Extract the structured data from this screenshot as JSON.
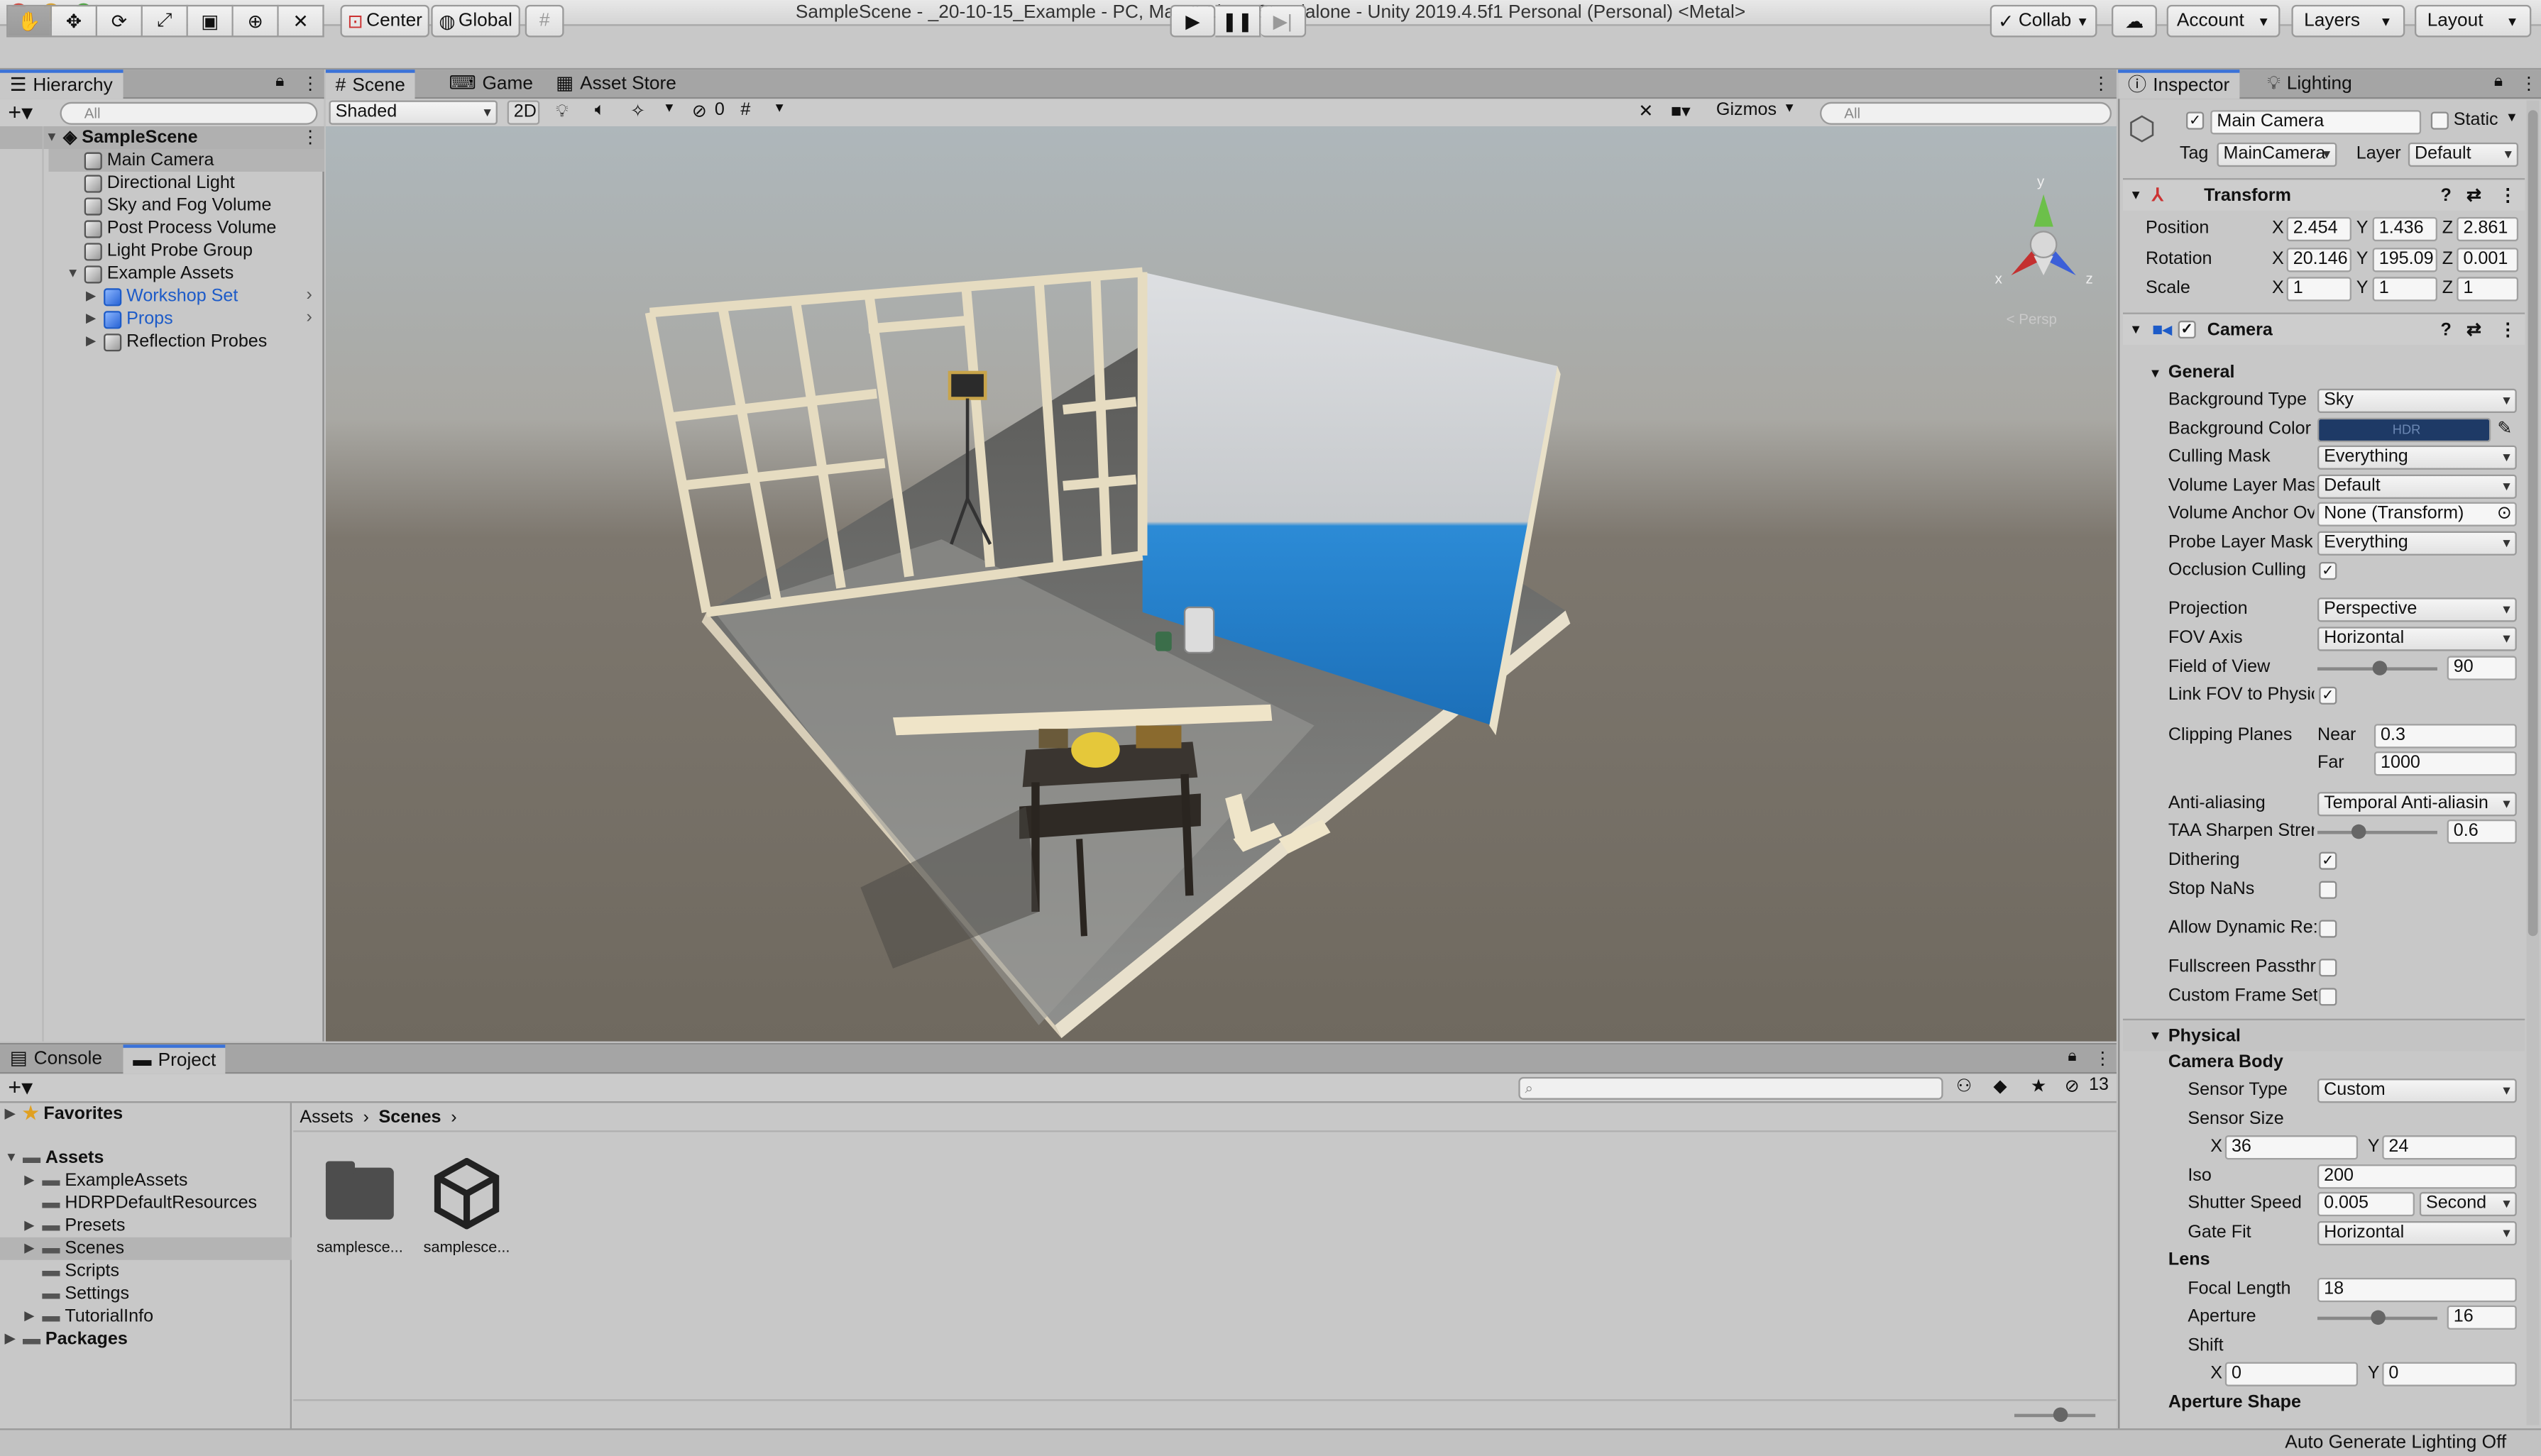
{
  "window": {
    "title": "SampleScene - _20-10-15_Example - PC, Mac & Linux Standalone - Unity 2019.4.5f1 Personal (Personal) <Metal>"
  },
  "toolbar": {
    "pivot_label": "Center",
    "space_label": "Global",
    "collab_label": "Collab",
    "account_label": "Account",
    "layers_label": "Layers",
    "layout_label": "Layout"
  },
  "hierarchy": {
    "tab_label": "Hierarchy",
    "search_placeholder": "All",
    "scene_name": "SampleScene",
    "items": [
      {
        "label": "Main Camera"
      },
      {
        "label": "Directional Light"
      },
      {
        "label": "Sky and Fog Volume"
      },
      {
        "label": "Post Process Volume"
      },
      {
        "label": "Light Probe Group"
      },
      {
        "label": "Example Assets"
      },
      {
        "label": "Workshop Set"
      },
      {
        "label": "Props"
      },
      {
        "label": "Reflection Probes"
      }
    ]
  },
  "scene_view": {
    "tabs": [
      "Scene",
      "Game",
      "Asset Store"
    ],
    "shading_mode": "Shaded",
    "mode_2d": "2D",
    "hidden_count": "0",
    "gizmos_label": "Gizmos",
    "search_placeholder": "All",
    "gizmo_y": "y",
    "gizmo_x": "x",
    "gizmo_z": "z",
    "projection_hint": "< Persp"
  },
  "bottom": {
    "tabs": [
      "Console",
      "Project"
    ],
    "filter_count": "13",
    "tree": [
      {
        "label": "Favorites",
        "bold": true
      },
      {
        "label": "Assets",
        "bold": true
      },
      {
        "label": "ExampleAssets"
      },
      {
        "label": "HDRPDefaultResources"
      },
      {
        "label": "Presets"
      },
      {
        "label": "Scenes"
      },
      {
        "label": "Scripts"
      },
      {
        "label": "Settings"
      },
      {
        "label": "TutorialInfo"
      },
      {
        "label": "Packages",
        "bold": true
      }
    ],
    "breadcrumb": [
      "Assets",
      "Scenes"
    ],
    "assets": [
      {
        "label": "samplesce...",
        "icon": "folder-icon"
      },
      {
        "label": "samplesce...",
        "icon": "unity-scene-icon"
      }
    ]
  },
  "inspector": {
    "tabs": [
      "Inspector",
      "Lighting"
    ],
    "object_name": "Main Camera",
    "static_label": "Static",
    "tag_label": "Tag",
    "tag_value": "MainCamera",
    "layer_label": "Layer",
    "layer_value": "Default",
    "transform": {
      "title": "Transform",
      "position_label": "Position",
      "rotation_label": "Rotation",
      "scale_label": "Scale",
      "position": {
        "x": "2.454",
        "y": "1.436",
        "z": "2.861"
      },
      "rotation": {
        "x": "20.146",
        "y": "195.09",
        "z": "0.001"
      },
      "scale": {
        "x": "1",
        "y": "1",
        "z": "1"
      }
    },
    "camera": {
      "title": "Camera",
      "general_label": "General",
      "background_type_label": "Background Type",
      "background_type": "Sky",
      "background_color_label": "Background Color",
      "background_color": "#1e3a66",
      "hdr_label": "HDR",
      "culling_mask_label": "Culling Mask",
      "culling_mask": "Everything",
      "volume_layer_label": "Volume Layer Mas",
      "volume_layer": "Default",
      "volume_anchor_label": "Volume Anchor Ov",
      "volume_anchor": "None (Transform)",
      "probe_layer_label": "Probe Layer Mask",
      "probe_layer": "Everything",
      "occlusion_label": "Occlusion Culling",
      "projection_label": "Projection",
      "projection": "Perspective",
      "fov_axis_label": "FOV Axis",
      "fov_axis": "Horizontal",
      "fov_label": "Field of View",
      "fov": "90",
      "link_fov_label": "Link FOV to Physic",
      "clipping_label": "Clipping Planes",
      "near_label": "Near",
      "near": "0.3",
      "far_label": "Far",
      "far": "1000",
      "aa_label": "Anti-aliasing",
      "aa": "Temporal Anti-aliasin",
      "taa_label": "TAA Sharpen Strer",
      "taa": "0.6",
      "dithering_label": "Dithering",
      "stop_nans_label": "Stop NaNs",
      "dynamic_res_label": "Allow Dynamic Re:",
      "fullscreen_label": "Fullscreen Passthr",
      "custom_frame_label": "Custom Frame Set"
    },
    "physical": {
      "title": "Physical",
      "camera_body_label": "Camera Body",
      "sensor_type_label": "Sensor Type",
      "sensor_type": "Custom",
      "sensor_size_label": "Sensor Size",
      "sensor_x": "36",
      "sensor_y": "24",
      "iso_label": "Iso",
      "iso": "200",
      "shutter_label": "Shutter Speed",
      "shutter": "0.005",
      "shutter_unit": "Second",
      "gate_fit_label": "Gate Fit",
      "gate_fit": "Horizontal",
      "lens_label": "Lens",
      "focal_label": "Focal Length",
      "focal": "18",
      "aperture_label": "Aperture",
      "aperture": "16",
      "shift_label": "Shift",
      "shift_x": "0",
      "shift_y": "0",
      "aperture_shape_label": "Aperture Shape"
    }
  },
  "status": {
    "text": "Auto Generate Lighting Off"
  }
}
